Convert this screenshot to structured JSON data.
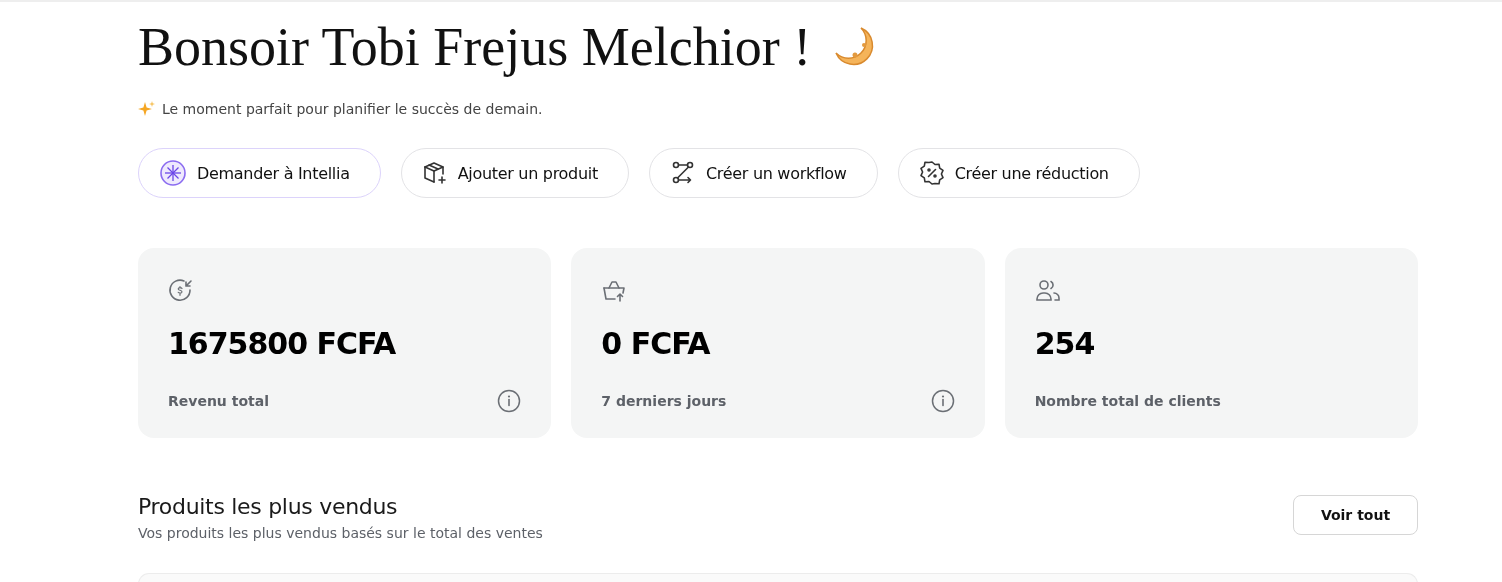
{
  "greeting": {
    "title": "Bonsoir Tobi Frejus Melchior !",
    "subtitle": "Le moment parfait pour planifier le succès de demain."
  },
  "actions": [
    {
      "kind": "flower",
      "label": "Demander à Intellia",
      "highlighted": true
    },
    {
      "kind": "box",
      "label": "Ajouter un produit",
      "highlighted": false
    },
    {
      "kind": "workflow",
      "label": "Créer un workflow",
      "highlighted": false
    },
    {
      "kind": "discount",
      "label": "Créer une réduction",
      "highlighted": false
    }
  ],
  "stats": [
    {
      "kind": "dollar",
      "value": "1675800 FCFA",
      "label": "Revenu total",
      "info": true
    },
    {
      "kind": "bag",
      "value": "0 FCFA",
      "label": "7 derniers jours",
      "info": true
    },
    {
      "kind": "users",
      "value": "254",
      "label": "Nombre total de clients",
      "info": false
    }
  ],
  "best_sellers": {
    "title": "Produits les plus vendus",
    "subtitle": "Vos produits les plus vendus basés sur le total des ventes",
    "button": "Voir tout"
  }
}
